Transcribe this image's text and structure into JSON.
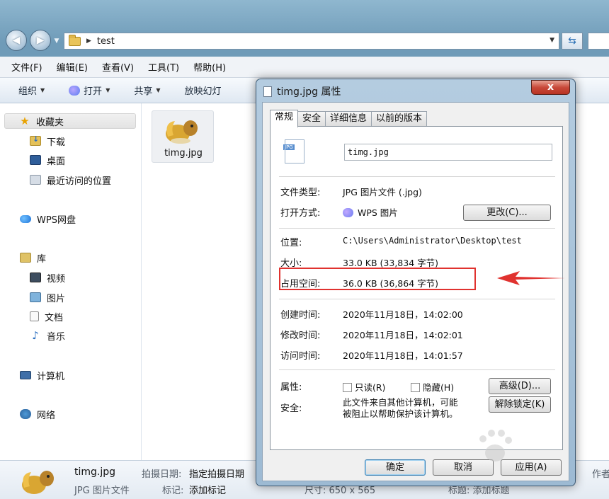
{
  "address": {
    "path": "test"
  },
  "menubar": [
    "文件(F)",
    "编辑(E)",
    "查看(V)",
    "工具(T)",
    "帮助(H)"
  ],
  "toolbar": {
    "organize": "组织",
    "open": "打开",
    "share": "共享",
    "slideshow": "放映幻灯"
  },
  "nav": {
    "favorites": "收藏夹",
    "downloads": "下载",
    "desktop": "桌面",
    "recent": "最近访问的位置",
    "wps": "WPS网盘",
    "libraries": "库",
    "videos": "视频",
    "pictures": "图片",
    "documents": "文档",
    "music": "音乐",
    "computer": "计算机",
    "network": "网络"
  },
  "file": {
    "name": "timg.jpg"
  },
  "details": {
    "name": "timg.jpg",
    "type": "JPG 图片文件",
    "date_label": "拍摄日期:",
    "date_value": "指定拍摄日期",
    "tag_label": "标记:",
    "tag_value": "添加标记",
    "size": "尺寸: 650 x 565",
    "title": "标题: 添加标题",
    "author": "作者"
  },
  "dialog": {
    "title": "timg.jpg 属性",
    "close": "x",
    "tabs": [
      "常规",
      "安全",
      "详细信息",
      "以前的版本"
    ],
    "filename": "timg.jpg",
    "type_label": "文件类型:",
    "type_value": "JPG 图片文件 (.jpg)",
    "open_label": "打开方式:",
    "open_value": "WPS 图片",
    "change_btn": "更改(C)...",
    "loc_label": "位置:",
    "loc_value": "C:\\Users\\Administrator\\Desktop\\test",
    "size_label": "大小:",
    "size_value": "33.0 KB (33,834 字节)",
    "disk_label": "占用空间:",
    "disk_value": "36.0 KB (36,864 字节)",
    "created_label": "创建时间:",
    "created_value": "2020年11月18日，14:02:00",
    "modified_label": "修改时间:",
    "modified_value": "2020年11月18日，14:02:01",
    "accessed_label": "访问时间:",
    "accessed_value": "2020年11月18日，14:01:57",
    "attr_label": "属性:",
    "readonly": "只读(R)",
    "hidden": "隐藏(H)",
    "advanced_btn": "高级(D)...",
    "security_label": "安全:",
    "security_text_1": "此文件来自其他计算机，可能",
    "security_text_2": "被阻止以帮助保护该计算机。",
    "unblock_btn": "解除锁定(K)",
    "ok": "确定",
    "cancel": "取消",
    "apply": "应用(A)"
  },
  "colors": {
    "highlight": "#e0322f",
    "title_bar": "#9dbad3",
    "close": "#c8493a"
  }
}
